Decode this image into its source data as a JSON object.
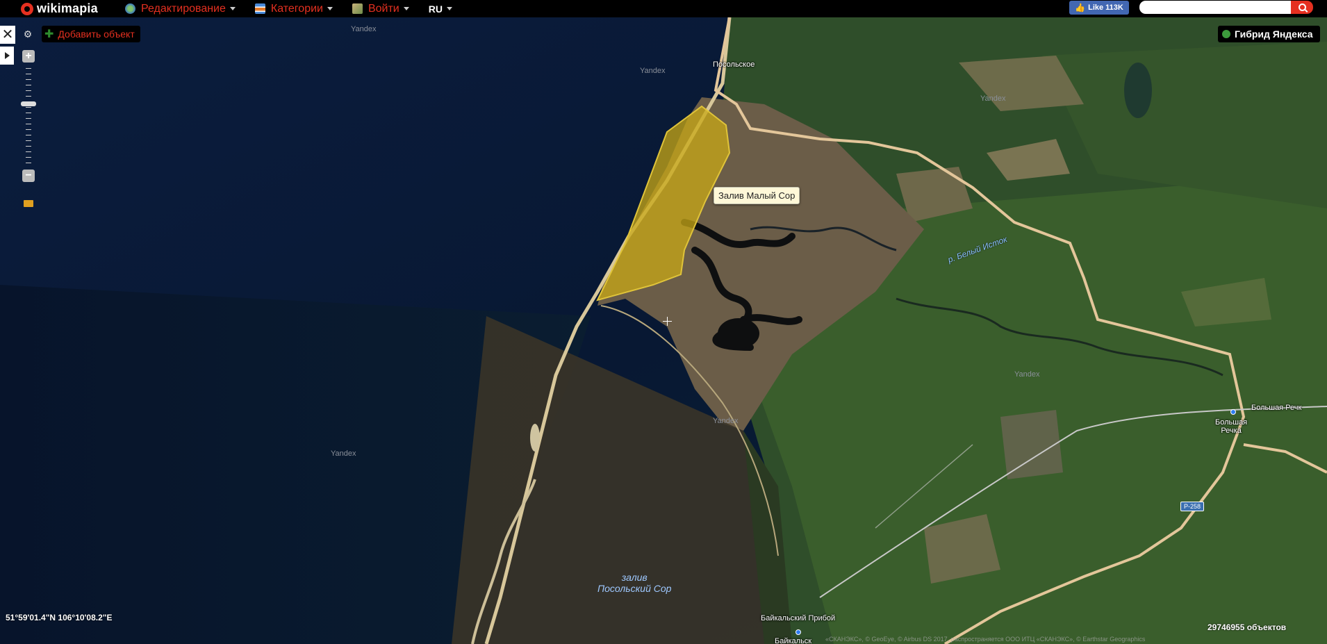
{
  "topbar": {
    "logo": "wikimapia",
    "menu": [
      {
        "label": "Редактирование"
      },
      {
        "label": "Категории"
      },
      {
        "label": "Войти"
      }
    ],
    "lang": "RU",
    "like": "Like 113K",
    "search_value": ""
  },
  "controls": {
    "close": "✕",
    "add_object": "Добавить объект",
    "zoom_in": "+",
    "zoom_out": "−",
    "layer": "Гибрид Яндекса"
  },
  "map": {
    "tooltip": "Залив Малый Сор",
    "places": {
      "posolskoe": "Посольское",
      "bolshaya_rechka_1": "Большая",
      "bolshaya_rechka_2": "Речка",
      "bolshaya_rechka_top": "Большая Речк",
      "baikalsky_priboy": "Байкальский Прибой",
      "baikalsk": "Байкальск"
    },
    "river": "р. Белый Исток",
    "bay_line1": "залив",
    "bay_line2": "Посольский Сор",
    "road": "Р-258",
    "watermark": "Yandex"
  },
  "footer": {
    "coords": "51°59'01.4\"N 106°10'08.2\"E",
    "objects": "29746955 объектов",
    "attribution": "«СКАНЭКС», © GeoEye, © Airbus DS 2017, распространяется ООО ИТЦ «СКАНЭКС», © Earthstar Geographics"
  },
  "colors": {
    "brand": "#e53020",
    "highlight_polygon": "#c8a816",
    "water": "#0a1a33",
    "land": "#2f5a2a"
  }
}
